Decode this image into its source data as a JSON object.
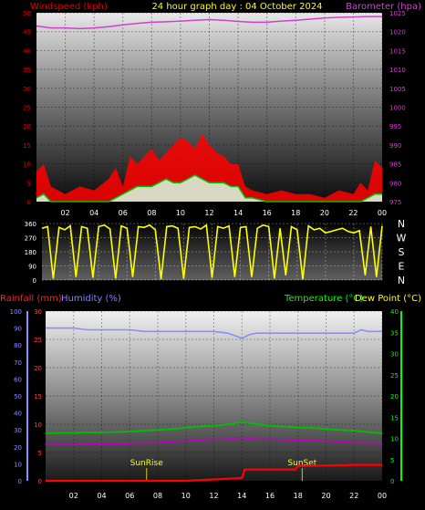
{
  "colors": {
    "wind": "#e00000",
    "gust": "#ff0000",
    "avg_wind": "#00c000",
    "baro": "#d040d0",
    "dir": "#ffff00",
    "rain": "#ff0000",
    "humidity": "#8c8cff",
    "temp": "#00c000",
    "dew": "#c000c0",
    "sun": "#d8c000",
    "green_axis": "#00ff00",
    "hum_label": "#8080ff",
    "rain_label": "#ff2020"
  },
  "chart_data": [
    {
      "id": "wind-baro",
      "type": "line",
      "title": "24 hour graph day : 04 October 2024",
      "ylabel_left": "Windspeed (kph)",
      "ylabel_right": "Barometer (hpa)",
      "x_ticks": [
        "02",
        "04",
        "06",
        "08",
        "10",
        "12",
        "14",
        "16",
        "18",
        "20",
        "22",
        "00"
      ],
      "y_left_ticks": [
        "0",
        "5",
        "10",
        "15",
        "20",
        "25",
        "30",
        "35",
        "40",
        "45",
        "50"
      ],
      "y_right_ticks": [
        "975",
        "980",
        "985",
        "990",
        "995",
        "1000",
        "1005",
        "1010",
        "1015",
        "1020",
        "1025"
      ],
      "ylim_left": [
        0,
        50
      ],
      "ylim_right": [
        975,
        1025
      ],
      "xlim": [
        0,
        24
      ],
      "series": [
        {
          "role": "gust",
          "x": [
            0.0,
            0.5,
            1.0,
            2.0,
            3.0,
            4.0,
            5.0,
            5.5,
            6.0,
            6.5,
            7.0,
            7.5,
            8.0,
            8.5,
            9.0,
            9.5,
            10.0,
            10.5,
            11.0,
            11.5,
            12.0,
            12.5,
            13.0,
            13.5,
            14.0,
            14.5,
            15.0,
            16.0,
            17.0,
            18.0,
            19.0,
            20.0,
            21.0,
            22.0,
            22.5,
            23.0,
            23.5,
            24.0
          ],
          "y": [
            8,
            10,
            4,
            2,
            4,
            3,
            6,
            9,
            4,
            12,
            10,
            12,
            14,
            11,
            13,
            15,
            17,
            16,
            14,
            18,
            15,
            13,
            12,
            10,
            10,
            4,
            3,
            2,
            3,
            2,
            2,
            1,
            3,
            2,
            5,
            3,
            11,
            9
          ]
        },
        {
          "role": "avg",
          "x": [
            0.0,
            0.5,
            1.0,
            2.0,
            3.0,
            4.0,
            5.0,
            5.5,
            6.0,
            6.5,
            7.0,
            7.5,
            8.0,
            8.5,
            9.0,
            9.5,
            10.0,
            10.5,
            11.0,
            11.5,
            12.0,
            12.5,
            13.0,
            13.5,
            14.0,
            14.5,
            15.0,
            16.0,
            17.0,
            18.0,
            19.0,
            20.0,
            21.0,
            22.0,
            22.5,
            23.0,
            23.5,
            24.0
          ],
          "y": [
            1,
            2,
            0,
            0,
            0,
            0,
            0,
            1,
            2,
            3,
            4,
            4,
            4,
            5,
            6,
            5,
            5,
            6,
            7,
            6,
            5,
            5,
            5,
            4,
            4,
            1,
            1,
            0,
            0,
            0,
            0,
            0,
            0,
            0,
            0,
            1,
            2,
            2
          ]
        },
        {
          "role": "baro",
          "name": "Barometer",
          "x": [
            0,
            1,
            2,
            3,
            4,
            5,
            6,
            7,
            8,
            9,
            10,
            11,
            12,
            13,
            14,
            15,
            16,
            17,
            18,
            19,
            20,
            21,
            22,
            23,
            24
          ],
          "y": [
            1021.5,
            1021.0,
            1021.0,
            1020.8,
            1021.0,
            1021.3,
            1021.8,
            1022.2,
            1022.5,
            1022.6,
            1022.8,
            1023.0,
            1023.2,
            1023.0,
            1022.7,
            1022.5,
            1022.5,
            1022.8,
            1023.0,
            1023.3,
            1023.6,
            1023.8,
            1023.9,
            1024.0,
            1024.0
          ]
        }
      ]
    },
    {
      "id": "wind-dir",
      "type": "line",
      "y_left_ticks": [
        "0",
        "90",
        "180",
        "270",
        "360"
      ],
      "y_right_ticks": [
        "N",
        "E",
        "S",
        "W",
        "N"
      ],
      "ylim": [
        0,
        360
      ],
      "xlim": [
        0,
        24
      ],
      "series": [
        {
          "role": "dir",
          "name": "Wind direction",
          "x": [
            0.0,
            0.4,
            0.8,
            1.2,
            1.6,
            2.0,
            2.4,
            2.8,
            3.2,
            3.6,
            4.0,
            4.4,
            4.8,
            5.2,
            5.6,
            6.0,
            6.4,
            6.8,
            7.2,
            7.6,
            8.0,
            8.4,
            8.8,
            9.2,
            9.6,
            10.0,
            10.4,
            10.8,
            11.2,
            11.6,
            12.0,
            12.4,
            12.8,
            13.2,
            13.6,
            14.0,
            14.4,
            14.8,
            15.2,
            15.6,
            16.0,
            16.4,
            16.8,
            17.2,
            17.6,
            18.0,
            18.4,
            18.8,
            19.2,
            19.6,
            20.0,
            20.4,
            20.8,
            21.2,
            21.6,
            22.0,
            22.4,
            22.8,
            23.2,
            23.6,
            24.0
          ],
          "y": [
            330,
            340,
            10,
            335,
            320,
            345,
            20,
            340,
            330,
            15,
            340,
            350,
            325,
            10,
            345,
            330,
            20,
            340,
            335,
            350,
            320,
            5,
            340,
            345,
            330,
            10,
            335,
            340,
            325,
            350,
            15,
            340,
            330,
            345,
            20,
            335,
            340,
            20,
            330,
            350,
            340,
            10,
            330,
            30,
            340,
            320,
            5,
            345,
            320,
            330,
            300,
            310,
            320,
            330,
            310,
            300,
            315,
            30,
            340,
            20,
            345
          ]
        }
      ]
    },
    {
      "id": "temp-hum-rain",
      "type": "line",
      "ylabel_left": "Rainfall (mm)",
      "ylabel_left2": "Humidity (%)",
      "ylabel_right": "Temperature (°C)",
      "ylabel_right2": "Dew Point (°C)",
      "x_ticks": [
        "02",
        "04",
        "06",
        "08",
        "10",
        "12",
        "14",
        "16",
        "18",
        "20",
        "22",
        "00"
      ],
      "y_rain_ticks": [
        "0",
        "5",
        "10",
        "15",
        "20",
        "25",
        "30"
      ],
      "y_hum_ticks": [
        "0",
        "10",
        "20",
        "30",
        "40",
        "50",
        "60",
        "70",
        "80",
        "90",
        "100"
      ],
      "y_temp_ticks": [
        "0",
        "5",
        "10",
        "15",
        "20",
        "25",
        "30",
        "35",
        "40"
      ],
      "ylim_rain": [
        0,
        30
      ],
      "ylim_hum": [
        0,
        100
      ],
      "ylim_temp": [
        0,
        40
      ],
      "xlim": [
        0,
        24
      ],
      "annotations": [
        {
          "label": "SunRise",
          "x": 7.2
        },
        {
          "label": "SunSet",
          "x": 18.3
        }
      ],
      "series": [
        {
          "role": "hum",
          "name": "Humidity",
          "x": [
            0,
            1,
            2,
            3,
            4,
            5,
            6,
            7,
            8,
            9,
            10,
            11,
            12,
            13,
            14,
            14.5,
            15,
            16,
            17,
            18,
            19,
            20,
            21,
            22,
            22.5,
            23,
            24
          ],
          "y": [
            90,
            90,
            90,
            89,
            89,
            89,
            89,
            88,
            88,
            88,
            88,
            88,
            88,
            87,
            84,
            86,
            87,
            87,
            87,
            87,
            87,
            87,
            87,
            87,
            89,
            88,
            88
          ]
        },
        {
          "role": "temp",
          "name": "Temperature",
          "x": [
            0,
            1,
            2,
            3,
            4,
            5,
            6,
            7,
            8,
            9,
            10,
            11,
            12,
            13,
            14,
            15,
            16,
            17,
            18,
            19,
            20,
            21,
            22,
            23,
            24
          ],
          "y": [
            11.2,
            11.3,
            11.3,
            11.4,
            11.4,
            11.5,
            11.6,
            11.8,
            12.0,
            12.2,
            12.5,
            12.8,
            13.0,
            13.3,
            13.8,
            13.4,
            13.0,
            12.8,
            12.5,
            12.5,
            12.2,
            12.0,
            11.8,
            11.5,
            11.2
          ]
        },
        {
          "role": "dew",
          "name": "Dew Point",
          "x": [
            0,
            2,
            4,
            6,
            8,
            10,
            12,
            13,
            14,
            15,
            16,
            18,
            20,
            22,
            24
          ],
          "y": [
            8.6,
            8.6,
            8.7,
            8.8,
            9.0,
            9.4,
            9.8,
            9.9,
            10.2,
            9.9,
            9.8,
            9.6,
            9.4,
            9.0,
            8.8
          ]
        },
        {
          "role": "rain",
          "name": "Rainfall",
          "x": [
            0,
            6.0,
            10.0,
            14.0,
            14.2,
            17.8,
            18.0,
            22.0,
            24
          ],
          "y": [
            0,
            0,
            0,
            0.5,
            2.0,
            2.0,
            2.6,
            2.8,
            2.8
          ]
        }
      ]
    }
  ]
}
